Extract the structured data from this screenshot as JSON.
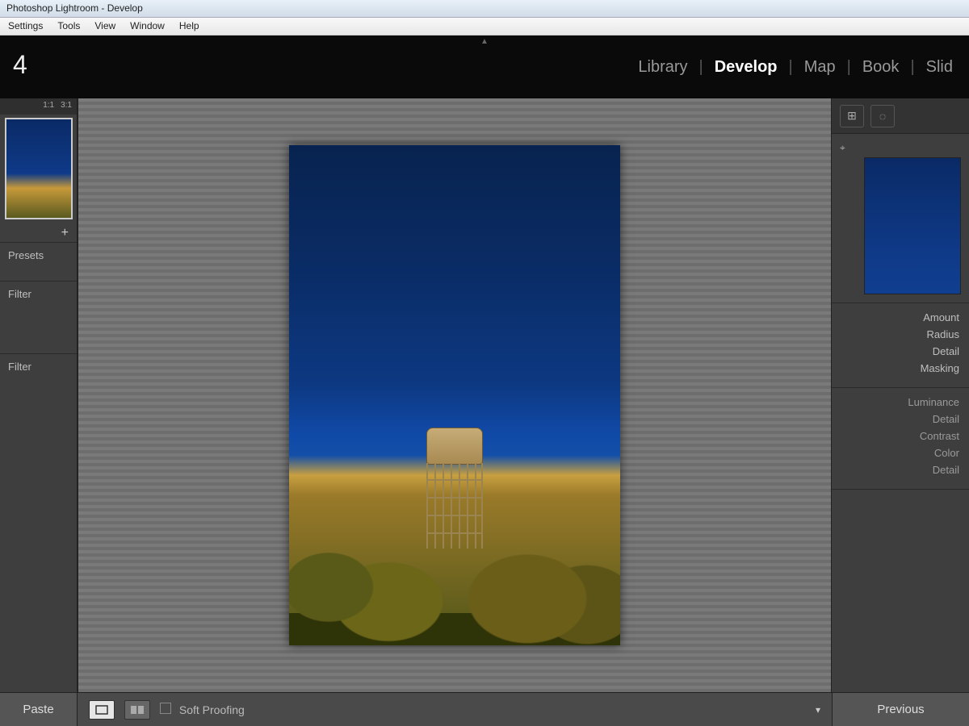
{
  "window": {
    "title": "Photoshop Lightroom - Develop"
  },
  "menu": {
    "items": [
      "Settings",
      "Tools",
      "View",
      "Window",
      "Help"
    ]
  },
  "identity": {
    "version_suffix": "4"
  },
  "modules": {
    "items": [
      "Library",
      "Develop",
      "Map",
      "Book",
      "Slid"
    ],
    "active": "Develop"
  },
  "navigator": {
    "zoom_labels": [
      "1:1",
      "3:1"
    ]
  },
  "left_panel": {
    "add_label": "+",
    "sections": [
      "Presets",
      "Filter",
      "Filter"
    ]
  },
  "right_panel": {
    "detail_pin": "⌖",
    "sharpening": {
      "labels": [
        "Amount",
        "Radius",
        "Detail",
        "Masking"
      ]
    },
    "noise": {
      "labels": [
        "Luminance",
        "Detail",
        "Contrast",
        "Color",
        "Detail"
      ]
    }
  },
  "toolbar": {
    "paste_label": "Paste",
    "soft_proofing_label": "Soft Proofing",
    "previous_label": "Previous"
  }
}
